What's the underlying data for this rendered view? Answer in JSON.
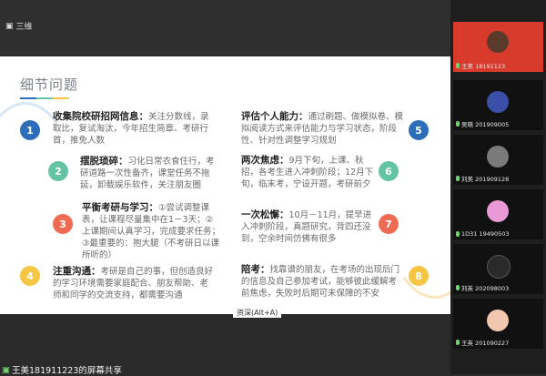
{
  "app": {
    "shared_by": "三维"
  },
  "slide": {
    "title": "细节问题",
    "page_indicator": "资深(Alt+A)",
    "items": [
      {
        "num": "1",
        "color": "#2c6fb8",
        "heading": "收集院校研招网信息：",
        "body": "关注分数线，录取比，复试淘汰，今年招生简章、考研行首，推免人数"
      },
      {
        "num": "2",
        "color": "#63c3a3",
        "heading": "摆脱琐碎：",
        "body": "习化日常衣食住行，考研道路一次性备齐，课堂任务不拖延，卸载娱乐软件，关注朋友圈"
      },
      {
        "num": "3",
        "color": "#ee6b53",
        "heading": "平衡考研与学习：",
        "body": "①尝试调整课表，让课程尽量集中在1－3天；②上课期间认真学习，完成要求任务；③最重要的：抱大腿（不考研日以课所听的）"
      },
      {
        "num": "4",
        "color": "#f5c544",
        "heading": "注重沟通：",
        "body": "考研是自己的事，但创造良好的学习环境需要家庭配合、朋友帮助、老师和同学的交流支持，都需要沟通"
      },
      {
        "num": "5",
        "color": "#2c6fb8",
        "heading": "评估个人能力：",
        "body": "通过刷题、做模拟卷、模拟阅读方式来评估能力与学习状态，阶段性、针对性调整学习规划"
      },
      {
        "num": "6",
        "color": "#63c3a3",
        "heading": "两次焦虑：",
        "body": "9月下旬，上课、秋招，各考生进入冲刺阶段；12月下旬，临末考，宁设开题，考研前夕"
      },
      {
        "num": "7",
        "color": "#ee6b53",
        "heading": "一次松懈：",
        "body": "10月－11月，提早进入冲刺阶段，真题研究，背四还没到，空余时间仿佛有很多"
      },
      {
        "num": "8",
        "color": "#f5c544",
        "heading": "陪考：",
        "body": "找靠谱的朋友，在考场的出现后门的信息及自己参加考试，能够彼此缓解考前焦虑，失败时后期可未保障的不安"
      }
    ]
  },
  "participants": [
    {
      "name": "王美 18191123",
      "bg": "#d83a2c",
      "avatar": "#5a3a2a"
    },
    {
      "name": "吴晓 201909005",
      "bg": "#0d0d0d",
      "avatar": "#3b4ea8"
    },
    {
      "name": "刘美 201909128",
      "bg": "#0d0d0d",
      "avatar": "#7a7a7a"
    },
    {
      "name": "1D31 19490503",
      "bg": "#0d0d0d",
      "avatar": "#e99ad6"
    },
    {
      "name": "刘英 202098003",
      "bg": "#0d0d0d",
      "avatar": "#2a2a2a"
    },
    {
      "name": "王英 201090227",
      "bg": "#0d0d0d",
      "avatar": "#f1c7b0"
    }
  ],
  "chat_toast": "王美181911223的屏幕共享"
}
